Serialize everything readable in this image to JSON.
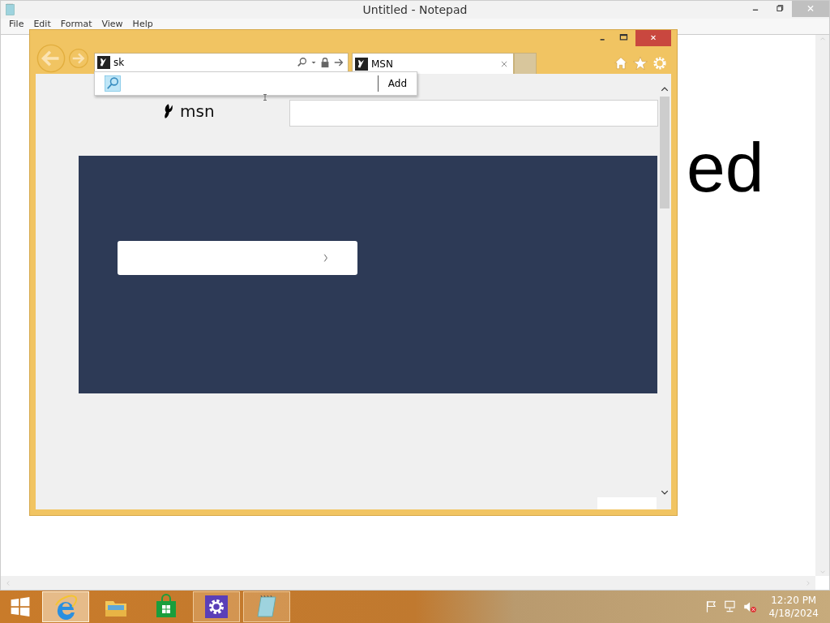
{
  "notepad": {
    "title": "Untitled - Notepad",
    "menu": [
      "File",
      "Edit",
      "Format",
      "View",
      "Help"
    ],
    "text_fragment": "ed"
  },
  "browser": {
    "address": {
      "value": "sk"
    },
    "suggestion": {
      "button": "Add"
    },
    "tabs": [
      {
        "label": "MSN",
        "selected": true
      }
    ],
    "page": {
      "logo": "msn"
    }
  },
  "taskbar": {
    "apps": [
      {
        "kind": "ie",
        "selected": true,
        "running": true
      },
      {
        "kind": "explorer",
        "selected": false,
        "running": false
      },
      {
        "kind": "store",
        "selected": false,
        "running": false
      },
      {
        "kind": "settings",
        "selected": false,
        "running": true
      },
      {
        "kind": "notepad",
        "selected": false,
        "running": true
      }
    ],
    "time": "12:20 PM",
    "date": "4/18/2024"
  }
}
